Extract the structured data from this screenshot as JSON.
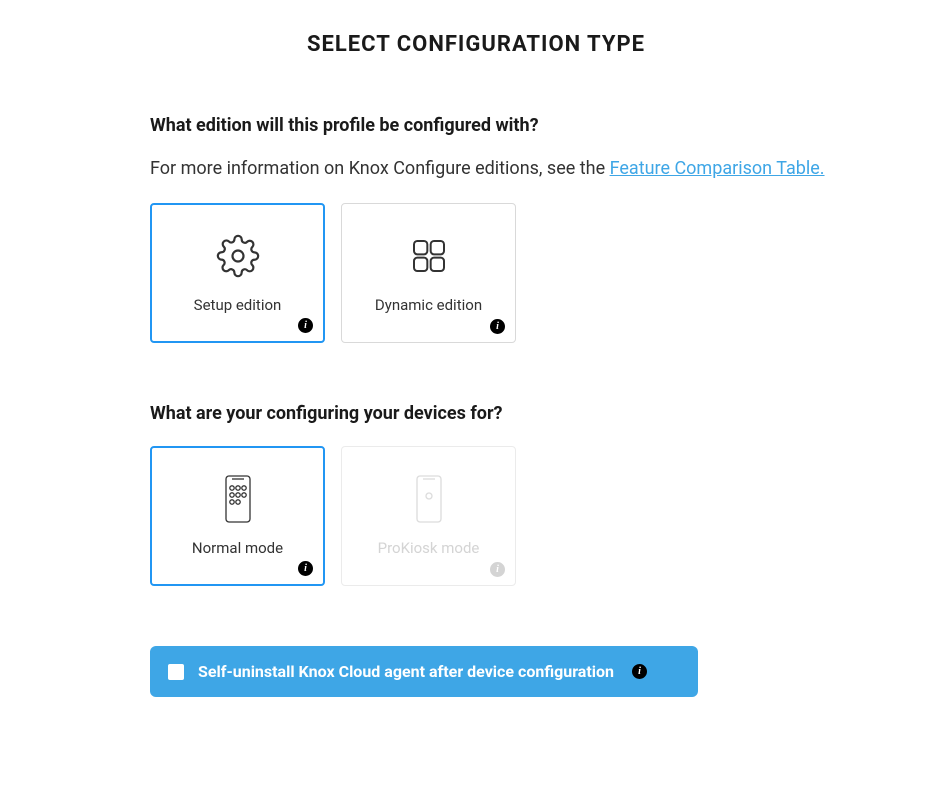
{
  "title": "SELECT CONFIGURATION TYPE",
  "section1": {
    "question": "What edition will this profile be configured with?",
    "info_prefix": "For more information on Knox Configure editions, see the ",
    "info_link": "Feature Comparison Table.",
    "options": [
      {
        "label": "Setup edition"
      },
      {
        "label": "Dynamic edition"
      }
    ]
  },
  "section2": {
    "question": "What are your configuring your devices for?",
    "options": [
      {
        "label": "Normal mode"
      },
      {
        "label": "ProKiosk mode"
      }
    ]
  },
  "banner": {
    "label": "Self-uninstall Knox Cloud agent after device configuration"
  }
}
